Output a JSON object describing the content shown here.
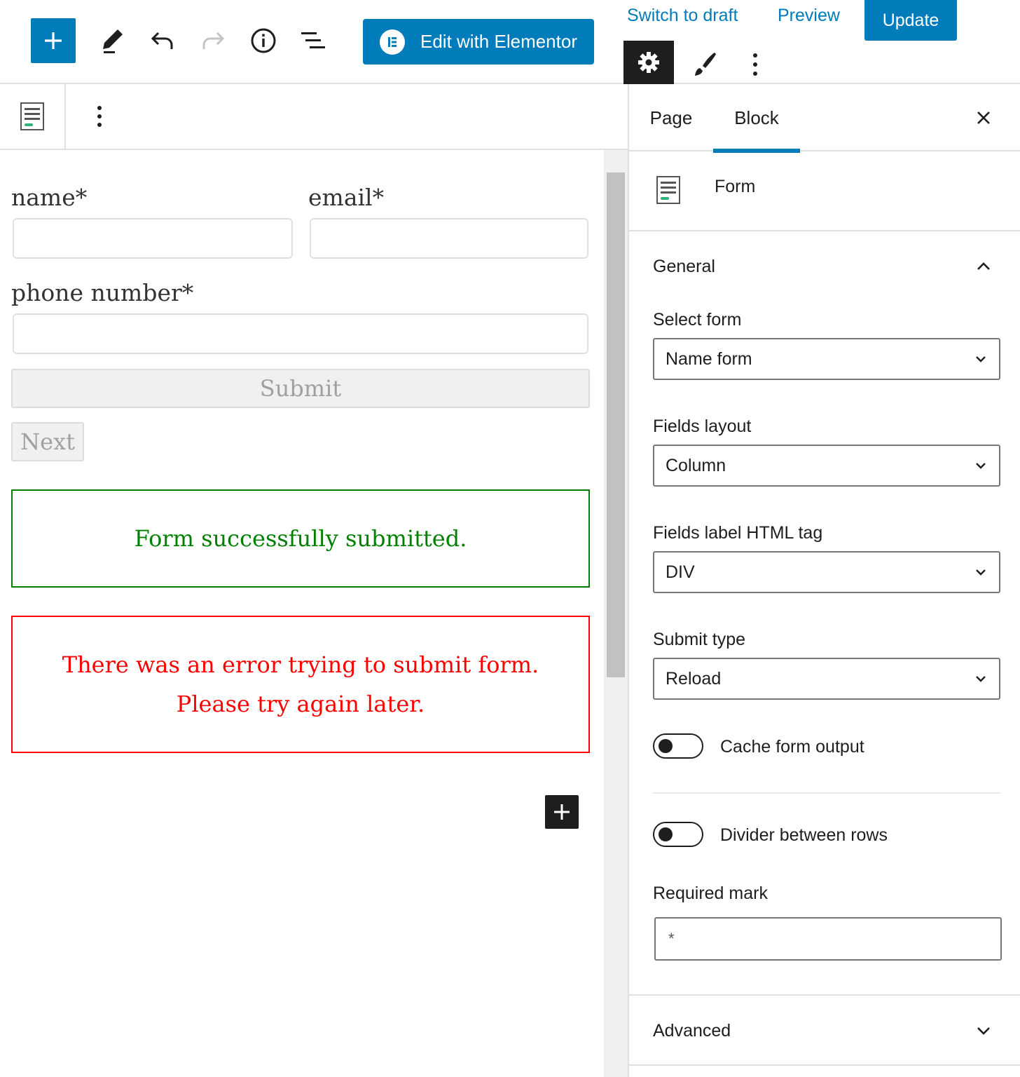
{
  "toolbar": {
    "elementor_label": "Edit with Elementor",
    "switch_to_draft": "Switch to draft",
    "preview": "Preview",
    "update": "Update"
  },
  "form": {
    "fields": {
      "name_label": "name*",
      "email_label": "email*",
      "phone_label": "phone number*"
    },
    "submit_label": "Submit",
    "next_label": "Next",
    "success_message": "Form successfully submitted.",
    "error_message_line1": "There was an error trying to submit form.",
    "error_message_line2": "Please try again later."
  },
  "sidebar": {
    "tabs": [
      {
        "label": "Page",
        "active": false
      },
      {
        "label": "Block",
        "active": true
      }
    ],
    "block_name": "Form",
    "general": {
      "title": "General",
      "select_form_label": "Select form",
      "select_form_value": "Name form",
      "fields_layout_label": "Fields layout",
      "fields_layout_value": "Column",
      "label_tag_label": "Fields label HTML tag",
      "label_tag_value": "DIV",
      "submit_type_label": "Submit type",
      "submit_type_value": "Reload",
      "cache_label": "Cache form output",
      "cache_on": false,
      "divider_label": "Divider between rows",
      "divider_on": false,
      "required_mark_label": "Required mark",
      "required_mark_value": "*"
    },
    "advanced_title": "Advanced"
  },
  "colors": {
    "accent": "#007cba",
    "success": "#008000",
    "error": "#ff0000",
    "dark": "#1e1e1e"
  },
  "icons": [
    "plus-icon",
    "pencil-icon",
    "undo-icon",
    "redo-icon",
    "info-icon",
    "list-view-icon",
    "elementor-icon",
    "gear-icon",
    "brush-icon",
    "more-vertical-icon",
    "form-block-icon",
    "close-icon",
    "chevron-up-icon",
    "chevron-down-icon"
  ]
}
